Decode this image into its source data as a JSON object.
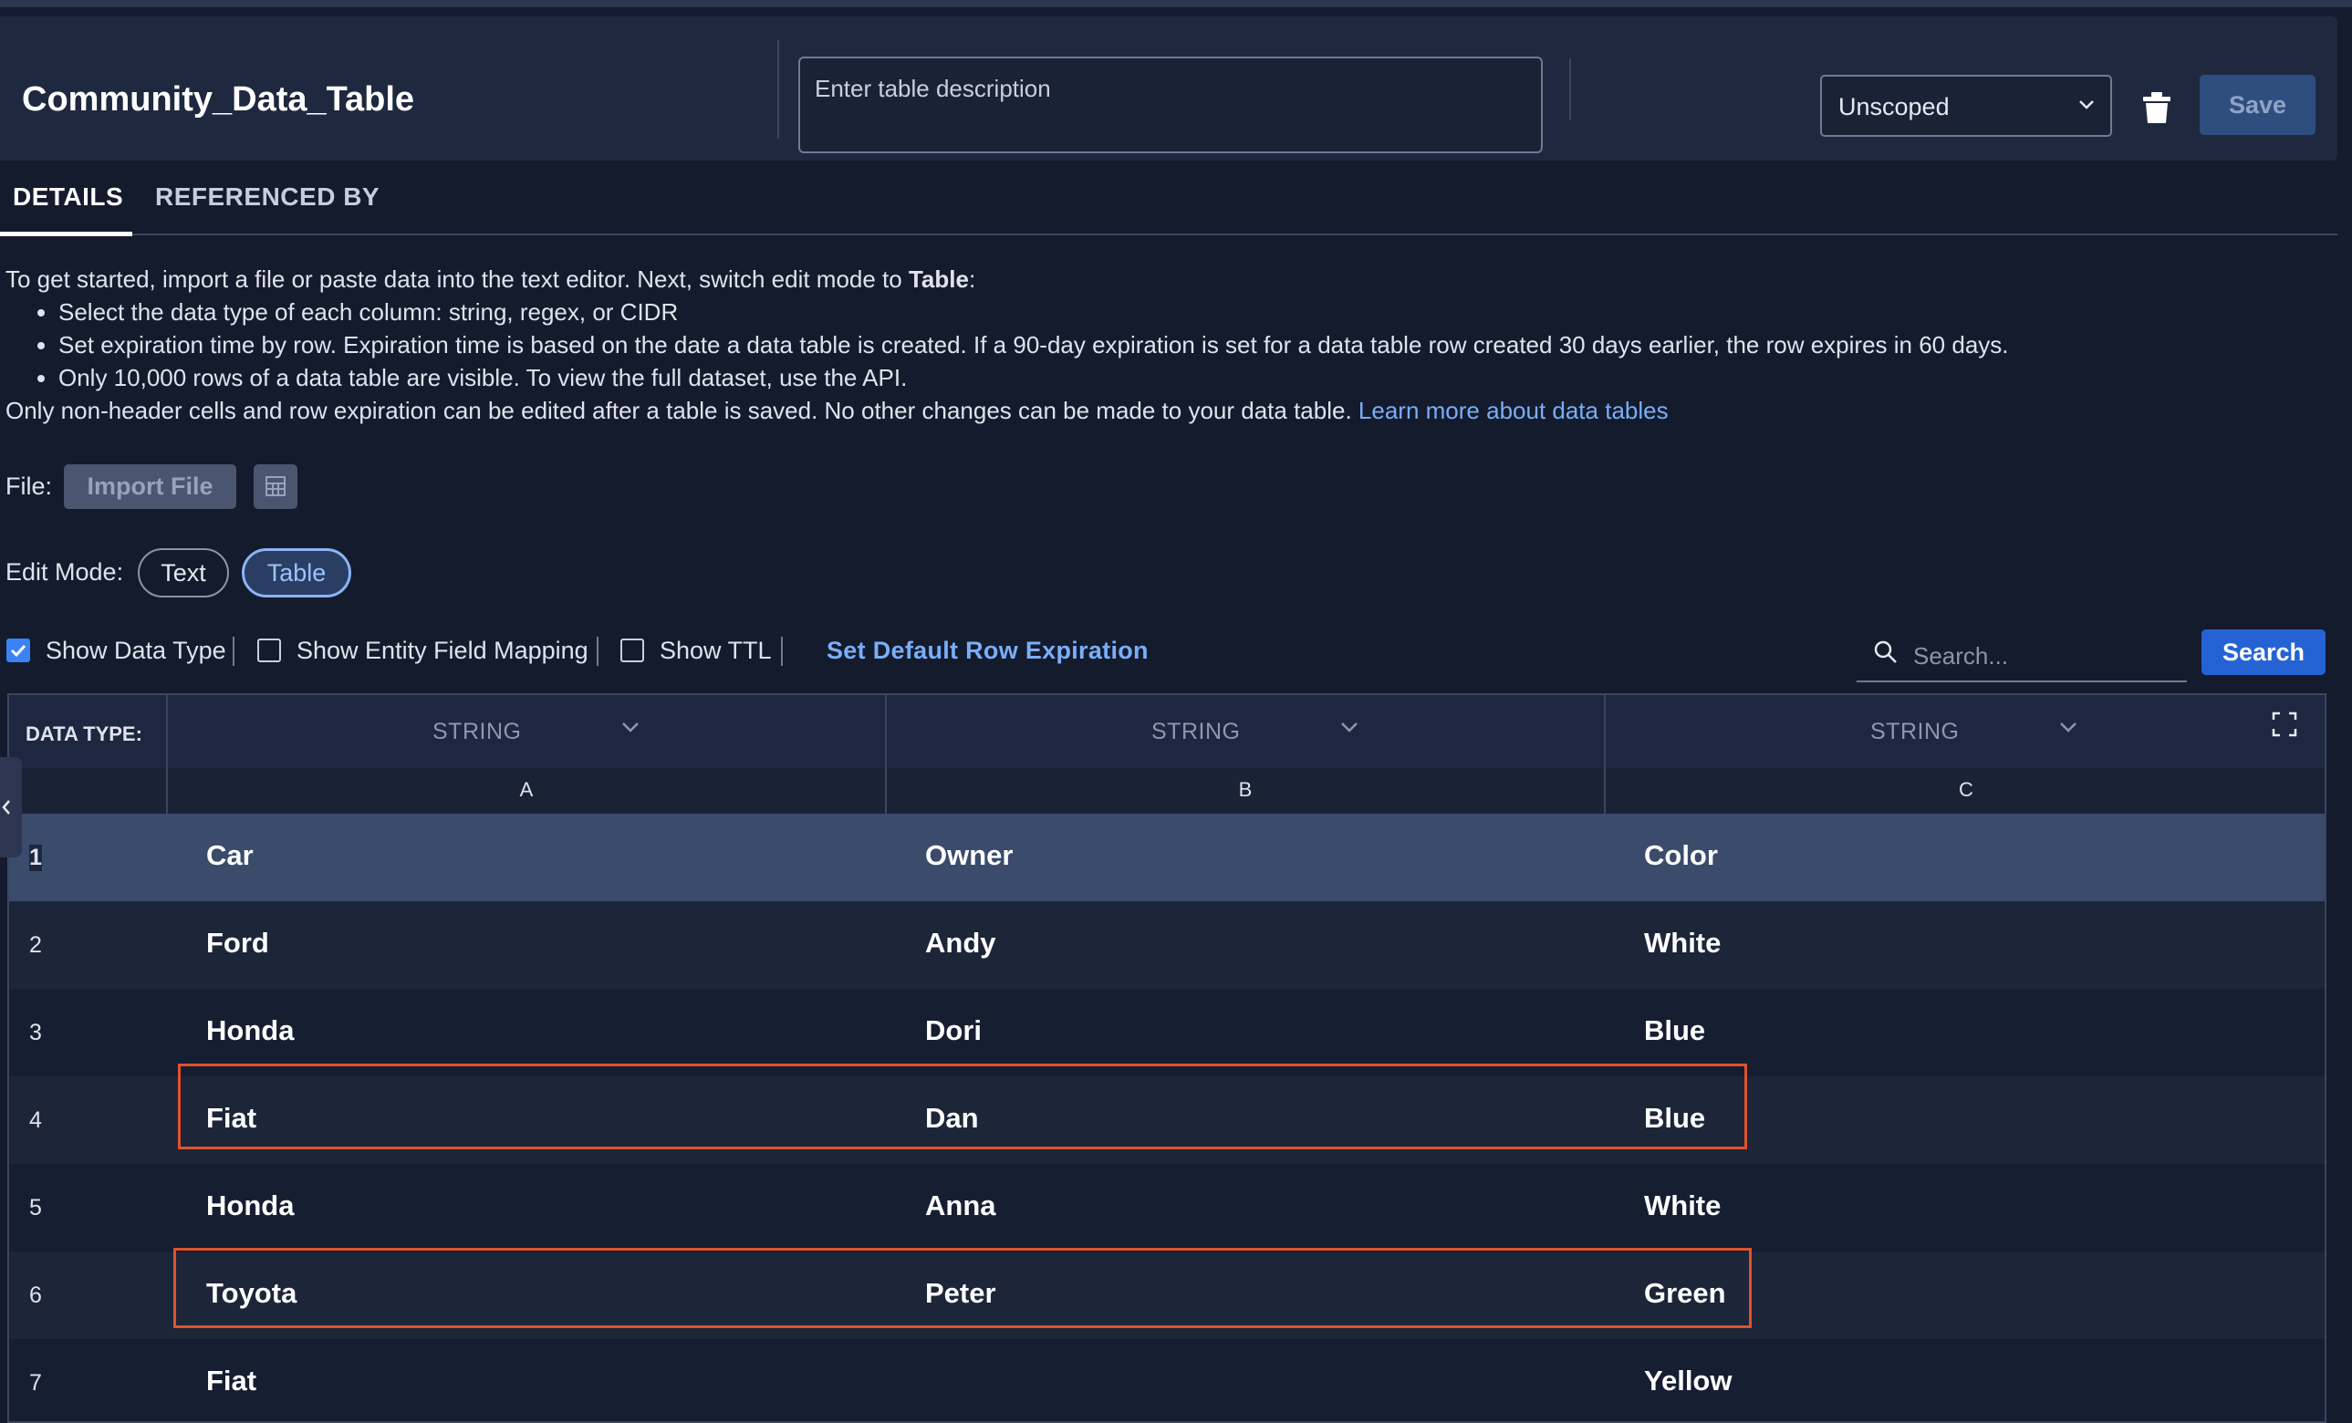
{
  "header": {
    "title": "Community_Data_Table",
    "description_placeholder": "Enter table description",
    "scope_value": "Unscoped",
    "save_label": "Save"
  },
  "tabs": [
    {
      "label": "DETAILS",
      "active": true
    },
    {
      "label": "REFERENCED BY",
      "active": false
    }
  ],
  "intro": {
    "lead": "To get started, import a file or paste data into the text editor. Next, switch edit mode to ",
    "lead_bold": "Table",
    "lead_end": ":",
    "bullets": [
      "Select the data type of each column: string, regex, or CIDR",
      "Set expiration time by row. Expiration time is based on the date a data table is created. If a 90-day expiration is set for a data table row created 30 days earlier, the row expires in 60 days.",
      "Only 10,000 rows of a data table are visible. To view the full dataset, use the API."
    ],
    "footer": "Only non-header cells and row expiration can be edited after a table is saved. No other changes can be made to your data table. ",
    "link": "Learn more about data tables"
  },
  "file": {
    "label": "File:",
    "import_label": "Import File"
  },
  "edit_mode": {
    "label": "Edit Mode:",
    "text_label": "Text",
    "table_label": "Table",
    "selected": "Table"
  },
  "options": {
    "show_data_type": {
      "label": "Show Data Type",
      "checked": true
    },
    "show_entity_mapping": {
      "label": "Show Entity Field Mapping",
      "checked": false
    },
    "show_ttl": {
      "label": "Show TTL",
      "checked": false
    },
    "expiration_link": "Set Default Row Expiration"
  },
  "search": {
    "placeholder": "Search...",
    "button_label": "Search"
  },
  "grid": {
    "data_type_label": "DATA TYPE:",
    "columns": [
      {
        "letter": "A",
        "type": "STRING"
      },
      {
        "letter": "B",
        "type": "STRING"
      },
      {
        "letter": "C",
        "type": "STRING"
      }
    ],
    "rows": [
      {
        "num": "1",
        "cells": [
          "Car",
          "Owner",
          "Color"
        ],
        "header": true
      },
      {
        "num": "2",
        "cells": [
          "Ford",
          "Andy",
          "White"
        ]
      },
      {
        "num": "3",
        "cells": [
          "Honda",
          "Dori",
          "Blue"
        ]
      },
      {
        "num": "4",
        "cells": [
          "Fiat",
          "Dan",
          "Blue"
        ],
        "highlighted": true
      },
      {
        "num": "5",
        "cells": [
          "Honda",
          "Anna",
          "White"
        ]
      },
      {
        "num": "6",
        "cells": [
          "Toyota",
          "Peter",
          "Green"
        ],
        "highlighted": true
      },
      {
        "num": "7",
        "cells": [
          "Fiat",
          "",
          "Yellow"
        ]
      }
    ]
  },
  "colors": {
    "accent": "#2563d4",
    "link": "#7aaef7",
    "highlight": "#e0522b",
    "background": "#141b2d"
  }
}
